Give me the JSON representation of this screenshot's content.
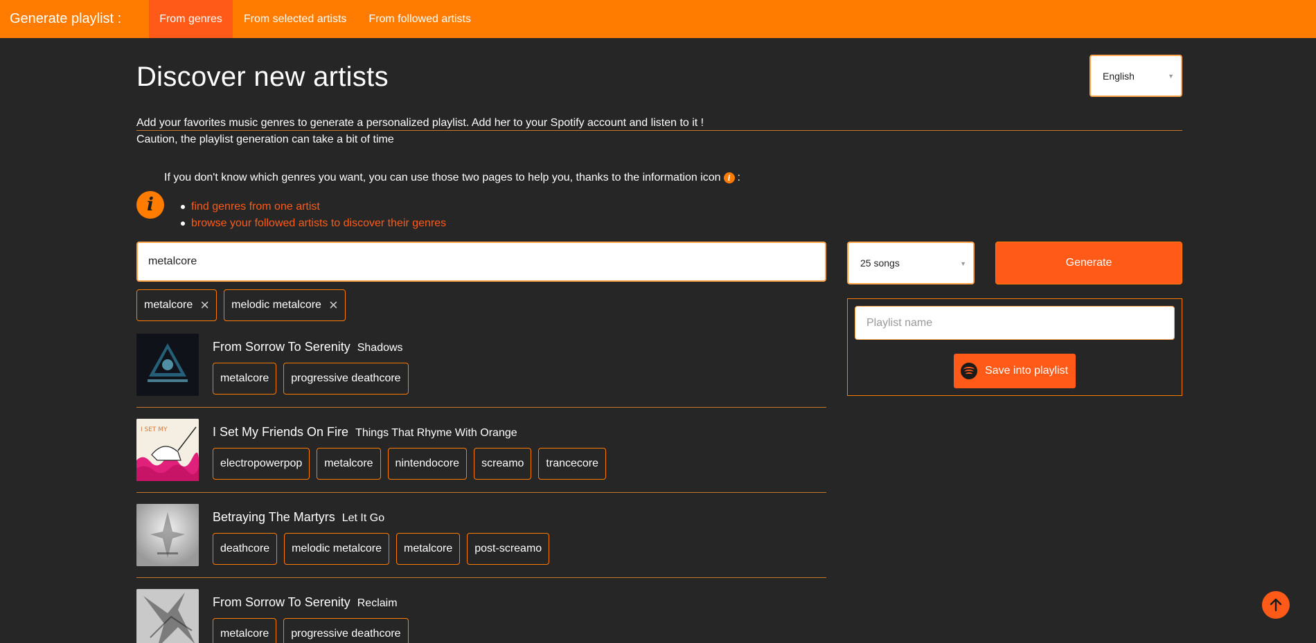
{
  "nav": {
    "brand": "Generate playlist :",
    "tabs": [
      {
        "label": "From genres",
        "active": true
      },
      {
        "label": "From selected artists",
        "active": false
      },
      {
        "label": "From followed artists",
        "active": false
      }
    ]
  },
  "header": {
    "title": "Discover new artists",
    "language": "English"
  },
  "intro": {
    "line1": "Add your favorites music genres to generate a personalized playlist. Add her to your Spotify account and listen to it !",
    "line2": "Caution, the playlist generation can take a bit of time"
  },
  "help": {
    "text": "If you don't know which genres you want, you can use those two pages to help you, thanks to the information icon",
    "suffix": ":",
    "links": [
      "find genres from one artist",
      "browse your followed artists to discover their genres"
    ]
  },
  "search": {
    "value": "metalcore"
  },
  "selected_genres": [
    "metalcore",
    "melodic metalcore"
  ],
  "controls": {
    "songs_count": "25 songs",
    "generate_label": "Generate",
    "playlist_placeholder": "Playlist name",
    "save_label": "Save into playlist"
  },
  "tracks": [
    {
      "artist": "From Sorrow To Serenity",
      "song": "Shadows",
      "genres": [
        "metalcore",
        "progressive deathcore"
      ]
    },
    {
      "artist": "I Set My Friends On Fire",
      "song": "Things That Rhyme With Orange",
      "genres": [
        "electropowerpop",
        "metalcore",
        "nintendocore",
        "screamo",
        "trancecore"
      ]
    },
    {
      "artist": "Betraying The Martyrs",
      "song": "Let It Go",
      "genres": [
        "deathcore",
        "melodic metalcore",
        "metalcore",
        "post-screamo"
      ]
    },
    {
      "artist": "From Sorrow To Serenity",
      "song": "Reclaim",
      "genres": [
        "metalcore",
        "progressive deathcore"
      ]
    }
  ],
  "colors": {
    "accent": "#ff7c00",
    "accent_dark": "#ff5a17",
    "background": "#262626"
  }
}
